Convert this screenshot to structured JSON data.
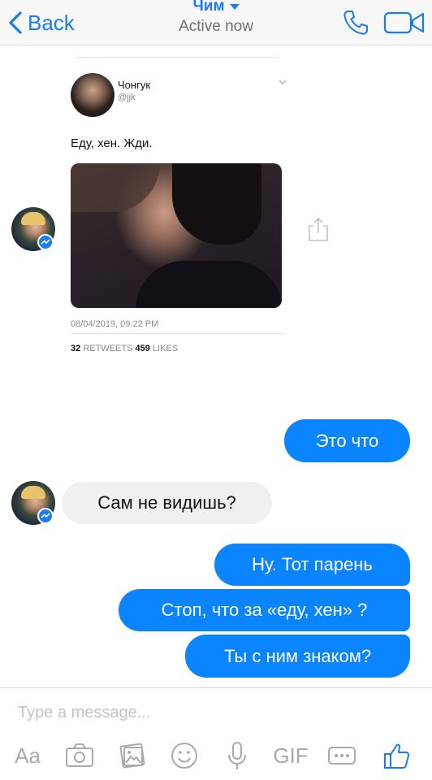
{
  "header": {
    "back_label": "Back",
    "contact_name": "Чим",
    "status": "Active now"
  },
  "tweet": {
    "author_name": "Чонгук",
    "author_handle": "@jjk",
    "text": "Еду, хен. Жди.",
    "date": "08/04/2019, 09:22 PM",
    "retweets": "32",
    "retweets_label": "RETWEETS",
    "likes": "459",
    "likes_label": "LIKES"
  },
  "messages": [
    {
      "id": "m1",
      "direction": "outgoing",
      "text": "Это что"
    },
    {
      "id": "m2",
      "direction": "incoming",
      "text": "Сам не видишь?"
    },
    {
      "id": "m3",
      "direction": "outgoing",
      "text": "Ну. Тот парень"
    },
    {
      "id": "m4",
      "direction": "outgoing",
      "text": "Стоп, что за «еду, хен» ?"
    },
    {
      "id": "m5",
      "direction": "outgoing",
      "text": "Ты с ним знаком?"
    }
  ],
  "composer": {
    "placeholder": "Type a message...",
    "aa_label": "Aa",
    "gif_label": "GIF"
  },
  "icons": {
    "header": [
      "back-chevron-icon",
      "caret-down-icon",
      "phone-icon",
      "video-camera-icon"
    ],
    "toolbar": [
      "text-format-icon",
      "camera-icon",
      "gallery-icon",
      "emoji-icon",
      "microphone-icon",
      "gif-icon",
      "more-icon",
      "thumbs-up-icon"
    ]
  },
  "colors": {
    "accent": "#1a7cf1",
    "outgoing_bubble": "#0a84ff",
    "incoming_bubble": "#f1f0f0",
    "header_bg": "#f7f7f8",
    "toolbar_icon": "#a9a9ae"
  }
}
